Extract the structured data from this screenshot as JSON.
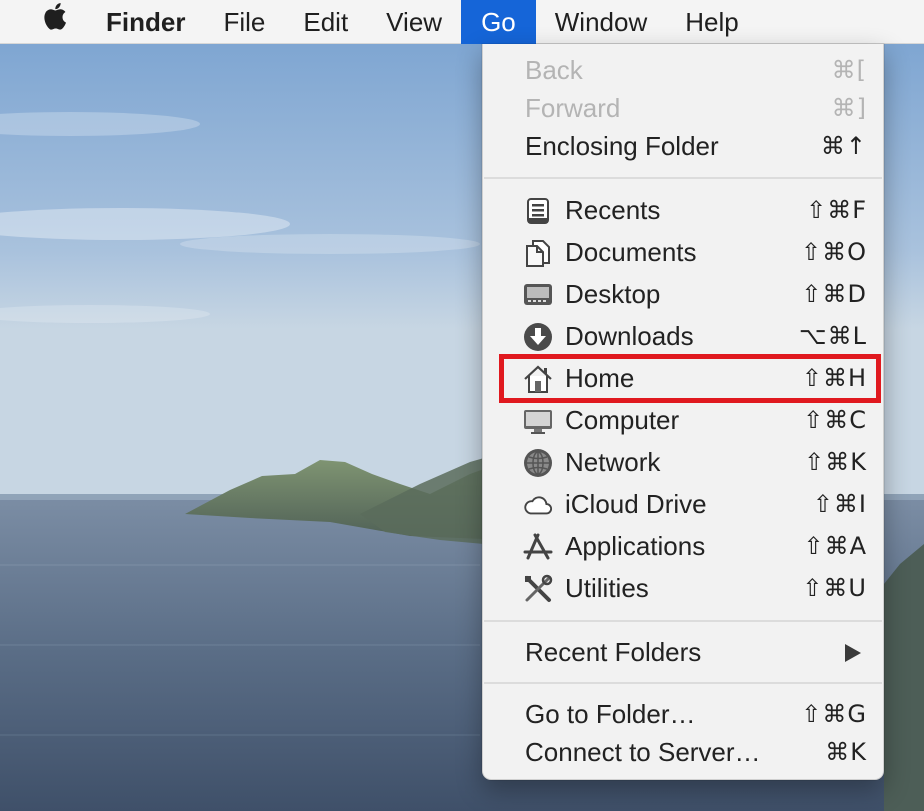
{
  "menubar": {
    "apple_icon": "apple-logo-icon",
    "items": [
      {
        "label": "Finder"
      },
      {
        "label": "File"
      },
      {
        "label": "Edit"
      },
      {
        "label": "View"
      },
      {
        "label": "Go"
      },
      {
        "label": "Window"
      },
      {
        "label": "Help"
      }
    ],
    "active_item": "Go",
    "active_color": "#1565d8"
  },
  "go_menu": {
    "sections": [
      {
        "items": [
          {
            "label": "Back",
            "shortcut": "⌘[",
            "enabled": false
          },
          {
            "label": "Forward",
            "shortcut": "⌘]",
            "enabled": false
          },
          {
            "label": "Enclosing Folder",
            "shortcut": "⌘↑",
            "enabled": true
          }
        ]
      },
      {
        "items": [
          {
            "label": "Recents",
            "shortcut": "⇧⌘F",
            "icon": "recents-icon"
          },
          {
            "label": "Documents",
            "shortcut": "⇧⌘O",
            "icon": "documents-icon"
          },
          {
            "label": "Desktop",
            "shortcut": "⇧⌘D",
            "icon": "desktop-icon"
          },
          {
            "label": "Downloads",
            "shortcut": "⌥⌘L",
            "icon": "downloads-icon"
          },
          {
            "label": "Home",
            "shortcut": "⇧⌘H",
            "icon": "home-icon",
            "highlighted": true
          },
          {
            "label": "Computer",
            "shortcut": "⇧⌘C",
            "icon": "computer-icon"
          },
          {
            "label": "Network",
            "shortcut": "⇧⌘K",
            "icon": "network-icon"
          },
          {
            "label": "iCloud Drive",
            "shortcut": "⇧⌘I",
            "icon": "icloud-icon"
          },
          {
            "label": "Applications",
            "shortcut": "⇧⌘A",
            "icon": "applications-icon"
          },
          {
            "label": "Utilities",
            "shortcut": "⇧⌘U",
            "icon": "utilities-icon"
          }
        ]
      },
      {
        "items": [
          {
            "label": "Recent Folders",
            "submenu": true,
            "icon": "submenu-arrow-icon"
          }
        ]
      },
      {
        "items": [
          {
            "label": "Go to Folder…",
            "shortcut": "⇧⌘G"
          },
          {
            "label": "Connect to Server…",
            "shortcut": "⌘K"
          }
        ]
      }
    ]
  },
  "annotation": {
    "highlight_color": "#e0191f",
    "highlighted_item": "Home"
  }
}
